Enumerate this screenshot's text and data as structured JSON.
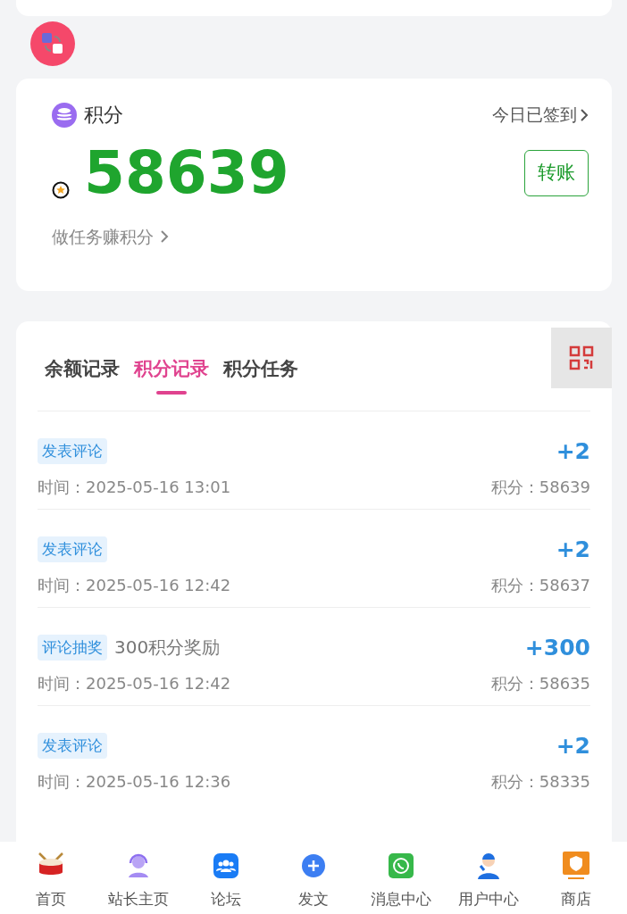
{
  "points_card": {
    "title": "积分",
    "checkin": "今日已签到",
    "balance": "58639",
    "transfer_button": "转账",
    "task_link": "做任务赚积分"
  },
  "tabs": [
    {
      "label": "余额记录",
      "selected": false
    },
    {
      "label": "积分记录",
      "selected": true
    },
    {
      "label": "积分任务",
      "selected": false
    }
  ],
  "records": [
    {
      "tag": "发表评论",
      "time": "时间：2025-05-16 13:01",
      "amount": "+2",
      "total": "积分：58639"
    },
    {
      "tag": "发表评论",
      "time": "时间：2025-05-16 12:42",
      "amount": "+2",
      "total": "积分：58637"
    },
    {
      "tag": "评论抽奖",
      "note": "300积分奖励",
      "time": "时间：2025-05-16 12:42",
      "amount": "+300",
      "total": "积分：58635"
    },
    {
      "tag": "发表评论",
      "time": "时间：2025-05-16 12:36",
      "amount": "+2",
      "total": "积分：58335"
    }
  ],
  "bottom_nav": [
    {
      "label": "首页"
    },
    {
      "label": "站长主页"
    },
    {
      "label": "论坛"
    },
    {
      "label": "发文"
    },
    {
      "label": "消息中心"
    },
    {
      "label": "用户中心"
    },
    {
      "label": "商店"
    }
  ]
}
